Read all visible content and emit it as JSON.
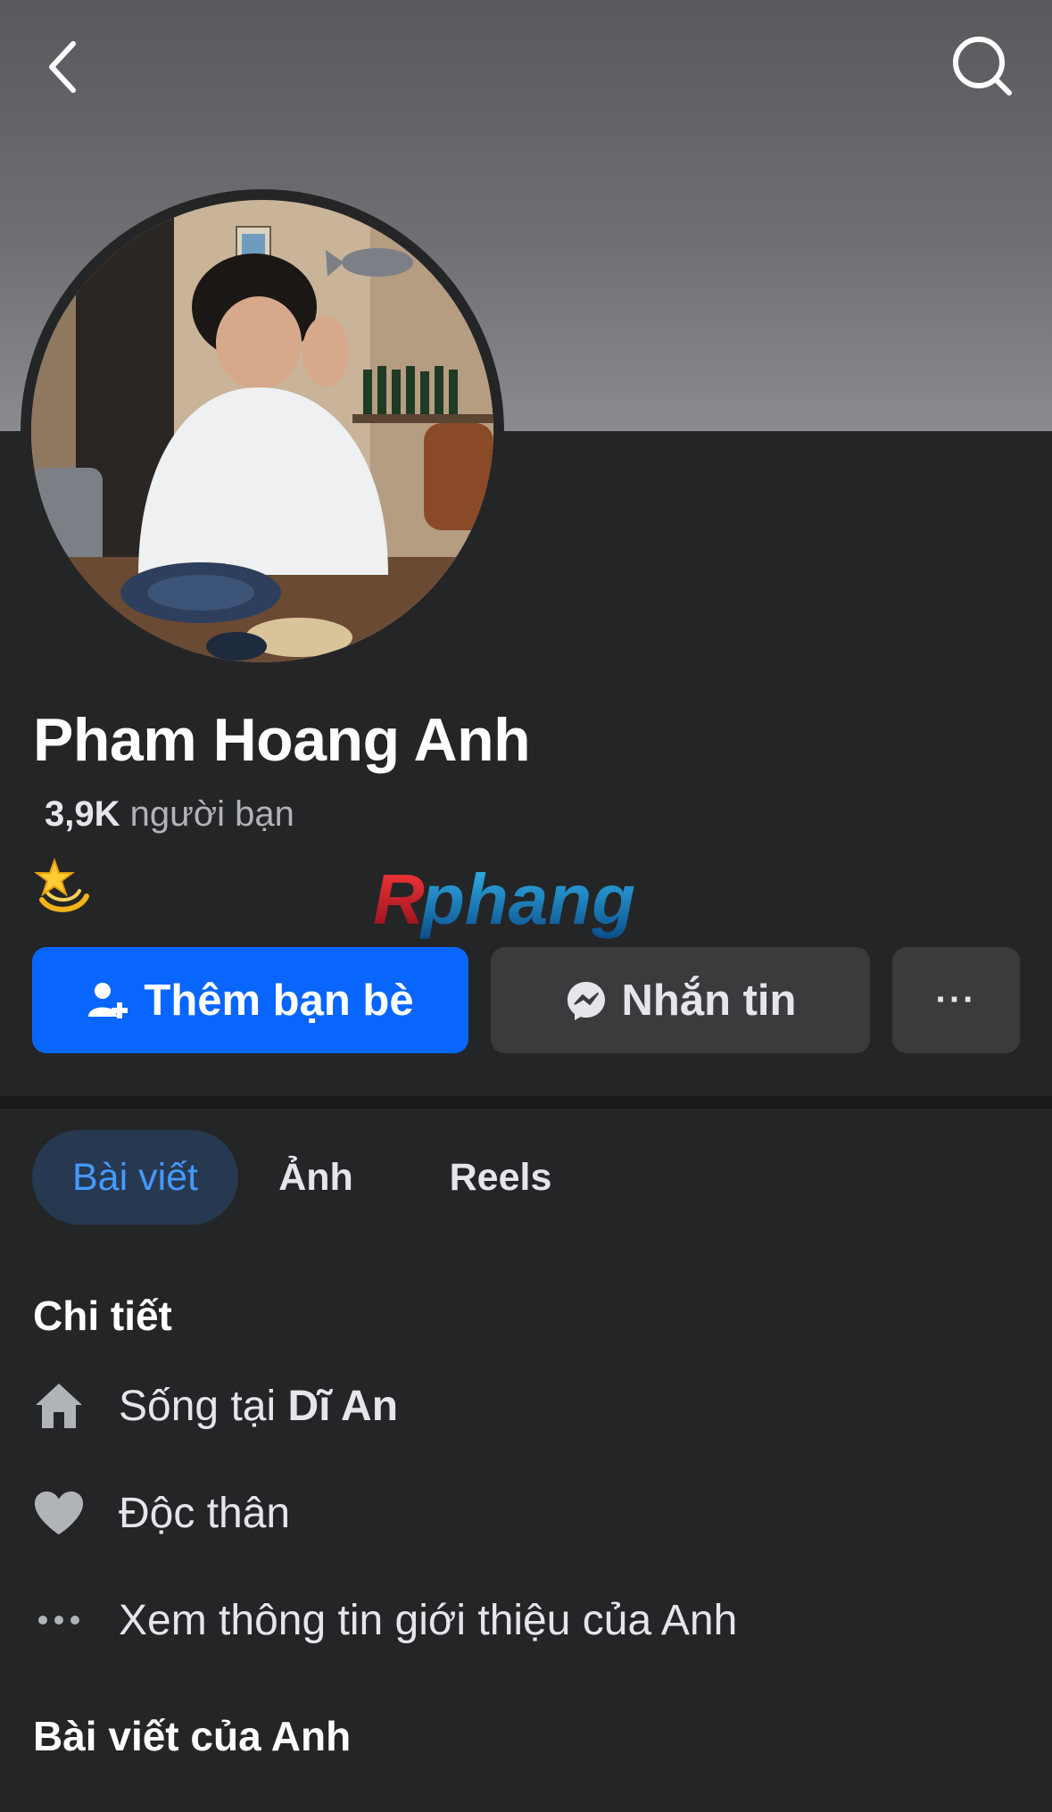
{
  "header": {
    "back_icon": "chevron-left-icon",
    "search_icon": "search-icon"
  },
  "profile": {
    "name": "Pham Hoang Anh",
    "friends_count": "3,9K",
    "friends_label": "người bạn",
    "bio_emoji": "💫"
  },
  "watermark": {
    "text": "Rphang"
  },
  "actions": {
    "add_friend_label": "Thêm bạn bè",
    "message_label": "Nhắn tin",
    "more_label": "···"
  },
  "tabs": [
    {
      "label": "Bài viết",
      "active": true
    },
    {
      "label": "Ảnh",
      "active": false
    },
    {
      "label": "Reels",
      "active": false
    }
  ],
  "details": {
    "title": "Chi tiết",
    "lives_prefix": "Sống tại",
    "lives_place": "Dĩ An",
    "relationship": "Độc thân",
    "see_about": "Xem thông tin giới thiệu của Anh"
  },
  "posts": {
    "title": "Bài viết của Anh"
  },
  "colors": {
    "background": "#242527",
    "primary_button": "#0866ff",
    "secondary_button": "#3a3b3c",
    "active_tab_bg": "#263951",
    "active_tab_text": "#4599ff"
  }
}
